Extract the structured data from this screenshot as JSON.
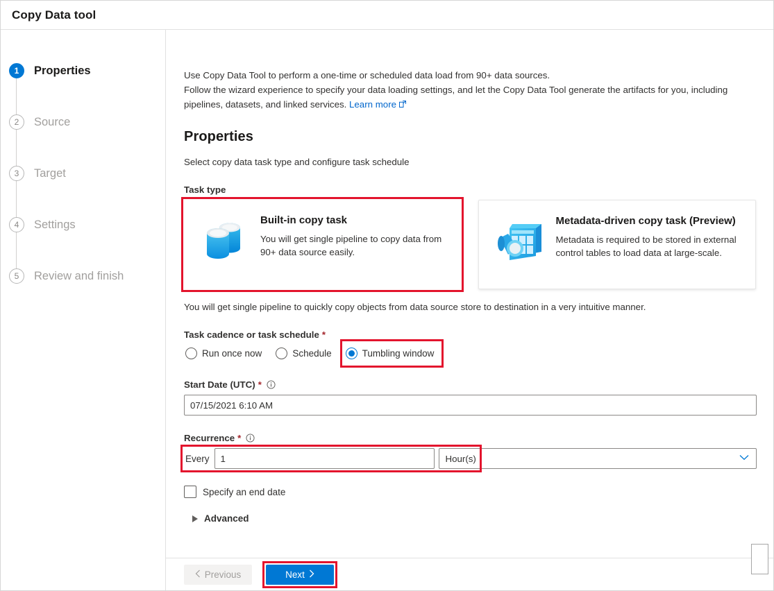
{
  "window": {
    "title": "Copy Data tool"
  },
  "sidebar": {
    "steps": [
      {
        "num": "1",
        "label": "Properties",
        "state": "active"
      },
      {
        "num": "2",
        "label": "Source",
        "state": "inactive"
      },
      {
        "num": "3",
        "label": "Target",
        "state": "inactive"
      },
      {
        "num": "4",
        "label": "Settings",
        "state": "inactive"
      },
      {
        "num": "5",
        "label": "Review and finish",
        "state": "inactive"
      }
    ]
  },
  "intro": {
    "line1": "Use Copy Data Tool to perform a one-time or scheduled data load from 90+ data sources.",
    "line2": "Follow the wizard experience to specify your data loading settings, and let the Copy Data Tool generate the artifacts for you, including",
    "line3": "pipelines, datasets, and linked services.",
    "link_label": "Learn more"
  },
  "section": {
    "title": "Properties",
    "subtitle": "Select copy data task type and configure task schedule"
  },
  "task_type": {
    "label": "Task type",
    "cards": [
      {
        "title": "Built-in copy task",
        "desc": "You will get single pipeline to copy data from 90+ data source easily.",
        "icon": "database-stack-icon",
        "selected": true,
        "highlighted": true
      },
      {
        "title": "Metadata-driven copy task (Preview)",
        "desc": "Metadata is required to be stored in external control tables to load data at large-scale.",
        "icon": "metadata-table-magnifier-icon",
        "selected": false,
        "highlighted": false
      }
    ],
    "note": "You will get single pipeline to quickly copy objects from data source store to destination in a very intuitive manner."
  },
  "cadence": {
    "label": "Task cadence or task schedule",
    "required": "*",
    "options": [
      {
        "label": "Run once now",
        "selected": false,
        "highlighted": false
      },
      {
        "label": "Schedule",
        "selected": false,
        "highlighted": false
      },
      {
        "label": "Tumbling window",
        "selected": true,
        "highlighted": true
      }
    ]
  },
  "start_date": {
    "label": "Start Date (UTC)",
    "required": "*",
    "value": "07/15/2021 6:10 AM",
    "placeholder": "",
    "has_info": true
  },
  "recurrence": {
    "label": "Recurrence",
    "required": "*",
    "has_info": true,
    "every_label": "Every",
    "interval_value": "1",
    "interval_placeholder": "",
    "unit_value": "Hour(s)",
    "highlighted": true
  },
  "end_date": {
    "label": "Specify an end date",
    "checked": false
  },
  "advanced": {
    "label": "Advanced",
    "expanded": false
  },
  "footer": {
    "previous_label": "Previous",
    "previous_disabled": true,
    "next_label": "Next",
    "next_highlighted": true
  },
  "colors": {
    "accent": "#0078d4",
    "highlight": "#e3142d",
    "link": "#0066cc",
    "required": "#a4262c"
  }
}
